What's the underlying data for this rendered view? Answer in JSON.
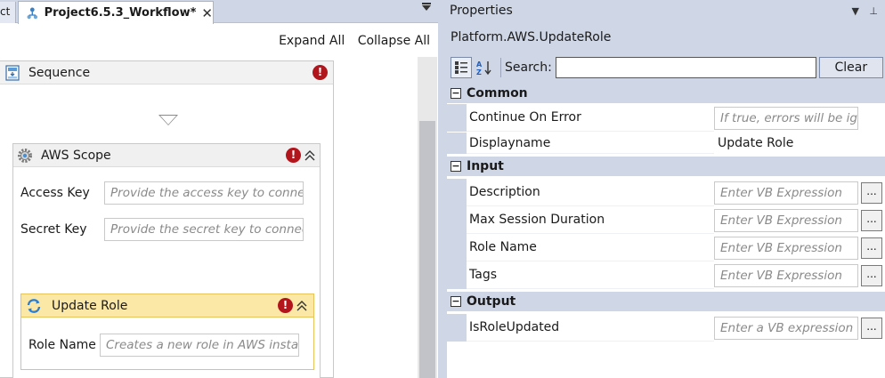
{
  "designer": {
    "prev_tab_fragment": "ct",
    "tab_title": "Project6.5.3_Workflow*",
    "close_glyph": "✕",
    "expand_all": "Expand All",
    "collapse_all": "Collapse All",
    "sequence": {
      "title": "Sequence",
      "error_glyph": "!"
    },
    "aws_scope": {
      "title": "AWS Scope",
      "access_key_label": "Access Key",
      "access_key_placeholder": "Provide the access key to connect",
      "secret_key_label": "Secret Key",
      "secret_key_placeholder": "Provide the secret key to connect"
    },
    "update_role": {
      "title": "Update Role",
      "role_name_label": "Role Name",
      "role_name_placeholder": "Creates a new role in AWS instance"
    }
  },
  "properties": {
    "panel_title": "Properties",
    "activity_type": "Platform.AWS.UpdateRole",
    "search_label": "Search:",
    "search_value": "",
    "clear_label": "Clear",
    "categories": {
      "common": "Common",
      "input": "Input",
      "output": "Output"
    },
    "rows": {
      "continue_on_error": {
        "name": "Continue On Error",
        "placeholder": "If true, errors will be ignored"
      },
      "displayname": {
        "name": "Displayname",
        "value": "Update Role"
      },
      "description": {
        "name": "Description",
        "placeholder": "Enter VB Expression"
      },
      "max_session_duration": {
        "name": "Max Session Duration",
        "placeholder": "Enter VB Expression"
      },
      "role_name": {
        "name": "Role Name",
        "placeholder": "Enter VB Expression"
      },
      "tags": {
        "name": "Tags",
        "placeholder": "Enter VB Expression"
      },
      "is_role_updated": {
        "name": "IsRoleUpdated",
        "placeholder": "Enter a VB expression"
      }
    },
    "ellipsis": "...",
    "minus_glyph": "−"
  },
  "colors": {
    "panel_bg": "#cfd6e5",
    "error_red": "#b3151c",
    "update_role_header": "#fbe8a6"
  }
}
